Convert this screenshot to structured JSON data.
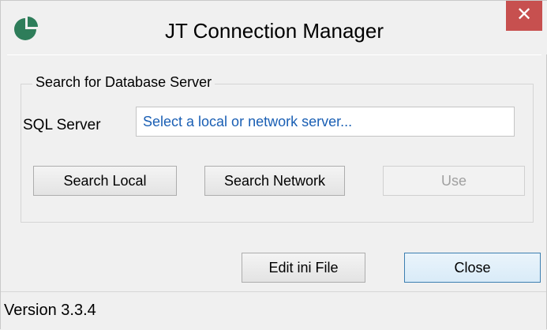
{
  "window": {
    "title": "JT Connection Manager",
    "icon": "app-pie-icon",
    "close_glyph": "✕",
    "accent_color": "#2e7d5a",
    "close_color": "#c7504f"
  },
  "search_group": {
    "legend": "Search for Database Server",
    "sql_label": "SQL Server",
    "sql_value": "Select a local or network server..."
  },
  "buttons": {
    "search_local": "Search Local",
    "search_network": "Search Network",
    "use": "Use",
    "edit_ini": "Edit ini File",
    "close": "Close"
  },
  "status": {
    "version": "Version 3.3.4"
  }
}
